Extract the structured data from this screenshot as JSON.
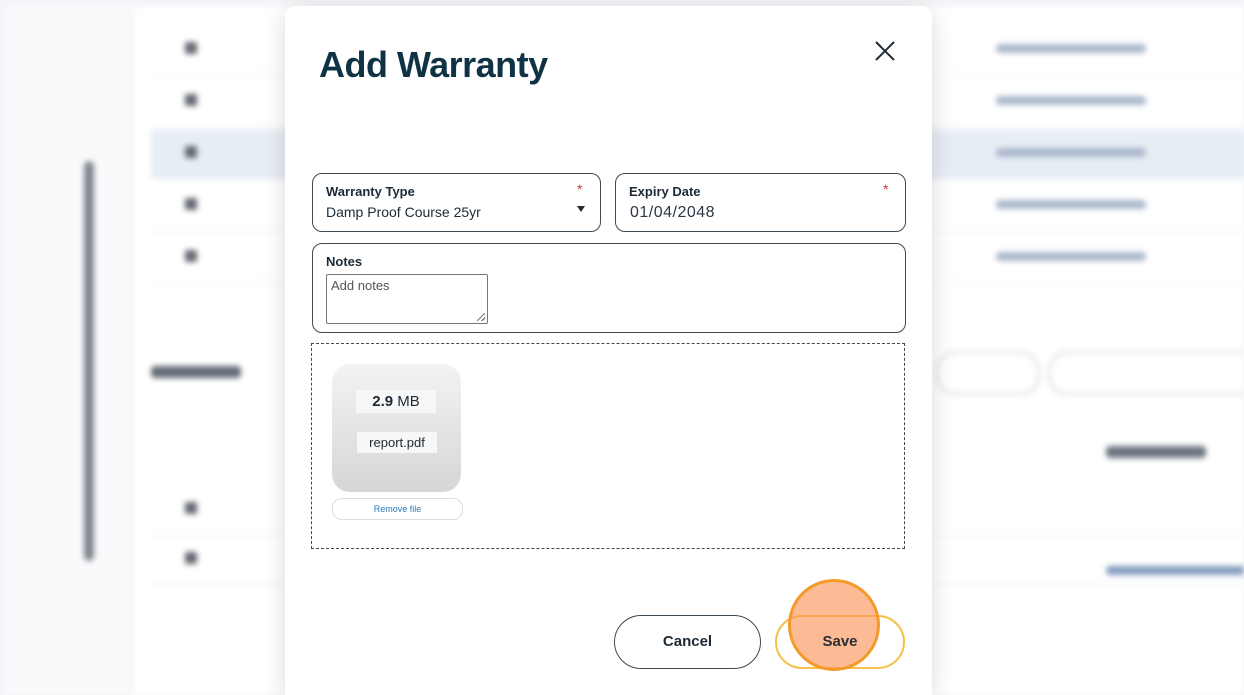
{
  "modal": {
    "title": "Add Warranty",
    "close_icon": "close-icon"
  },
  "fields": {
    "warranty_type": {
      "label": "Warranty Type",
      "required_mark": "*",
      "value": "Damp Proof Course 25yr"
    },
    "expiry_date": {
      "label": "Expiry Date",
      "required_mark": "*",
      "value": "01/04/2048"
    },
    "notes": {
      "label": "Notes",
      "placeholder": "Add notes"
    }
  },
  "attachment": {
    "size_value": "2.9",
    "size_unit": "MB",
    "file_name": "report.pdf",
    "remove_label": "Remove file"
  },
  "actions": {
    "cancel_label": "Cancel",
    "save_label": "Save"
  },
  "colors": {
    "title": "#0f3344",
    "required": "#d0343a",
    "save_border": "#f5c04a",
    "click_marker": "#f39a28",
    "link": "#2a7ab8"
  }
}
